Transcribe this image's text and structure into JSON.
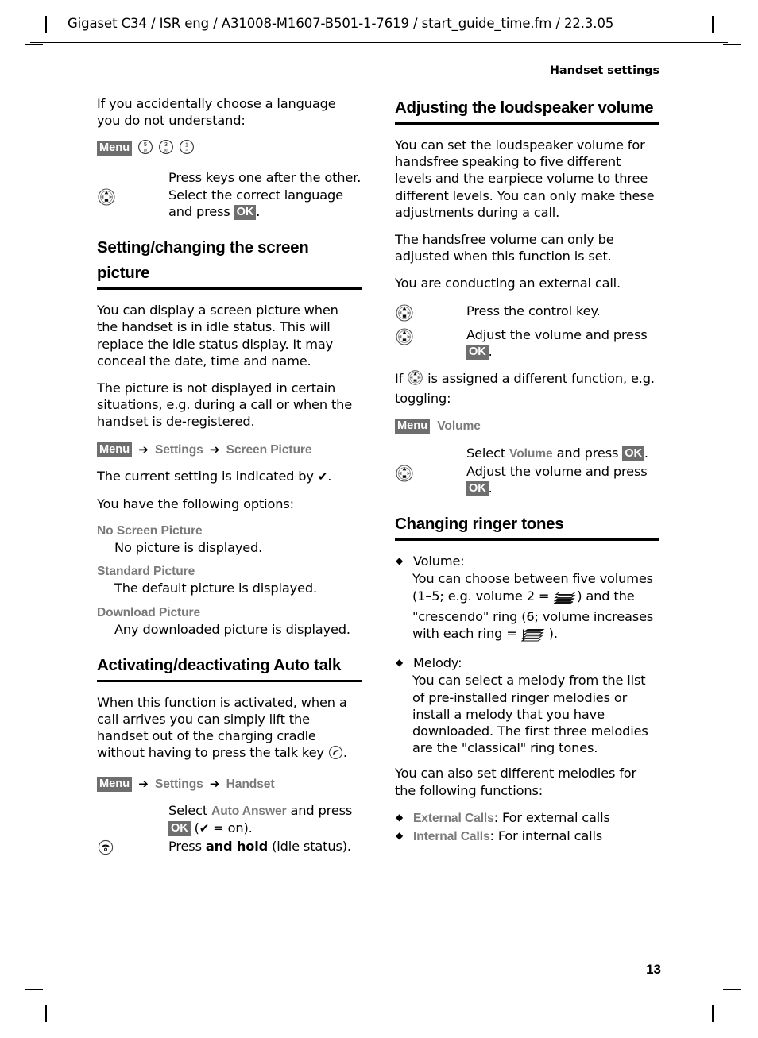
{
  "header": {
    "running_head": "Gigaset C34 / ISR eng / A31008-M1607-B501-1-7619 / start_guide_time.fm / 22.3.05",
    "chapter_label": "Handset settings"
  },
  "left_column": {
    "intro_paragraph": "If you accidentally choose a language you do not understand:",
    "language_steps": {
      "menu_key_label": "Menu",
      "keypad_icons": [
        "key-5-jkl-icon",
        "key-3-def-icon",
        "key-1-icon"
      ],
      "step1_text": "Press keys one after the other.",
      "step2_icon": "control-key-icon",
      "step2_text_before": "Select the correct language and press ",
      "step2_ok_label": "OK",
      "step2_text_after": "."
    },
    "section_screen_picture": {
      "heading": "Setting/changing the screen picture",
      "para1": "You can display a screen picture when the handset is in idle status. This will replace the idle status display. It may conceal the date, time and name.",
      "para2": "The picture is not displayed in certain situations, e.g. during a call or when the handset is de-registered.",
      "menu_path": {
        "menu_key_label": "Menu",
        "arrow": "➔",
        "item1": "Settings",
        "item2": "Screen Picture"
      },
      "para3_before": "The current setting is indicated by ",
      "para3_check": "✔",
      "para3_after": ".",
      "para4": "You have the following options:",
      "options": [
        {
          "term": "No Screen Picture",
          "desc": "No picture is displayed."
        },
        {
          "term": "Standard Picture",
          "desc": "The default picture is displayed."
        },
        {
          "term": "Download Picture",
          "desc": "Any downloaded picture is displayed."
        }
      ]
    },
    "section_auto_talk": {
      "heading": "Activating/deactivating Auto talk",
      "para1_before": "When this function is activated, when a call arrives you can simply lift the handset out of the charging cradle without having to press the talk key ",
      "para1_icon": "talk-key-icon",
      "para1_after": ".",
      "menu_path": {
        "menu_key_label": "Menu",
        "arrow": "➔",
        "item1": "Settings",
        "item2": "Handset"
      },
      "step1_text_before": "Select ",
      "step1_term": "Auto Answer",
      "step1_text_mid": " and press ",
      "step1_ok_label": "OK",
      "step1_text_after_open": " (",
      "step1_check": "✔",
      "step1_text_after": " = on).",
      "step2_icon": "end-call-key-icon",
      "step2_text_before": "Press ",
      "step2_bold": "and hold",
      "step2_text_after": " (idle status)."
    }
  },
  "right_column": {
    "section_loudspeaker": {
      "heading": "Adjusting the loudspeaker volume",
      "para1": "You can set the loudspeaker volume for handsfree speaking to five different levels and the earpiece volume to three different levels. You can only make these adjustments during a call.",
      "para2": "The handsfree volume can only be adjusted when this function is set.",
      "para3": "You are conducting an external call.",
      "step1_icon": "control-key-icon",
      "step1_text": "Press the control key.",
      "step2_icon": "control-key-icon",
      "step2_text_before": "Adjust the volume and press ",
      "step2_ok_label": "OK",
      "step2_text_after": ".",
      "cond_before": "If ",
      "cond_icon": "control-key-icon",
      "cond_after": " is assigned a different function, e.g. toggling:",
      "menu_line": {
        "menu_key_label": "Menu",
        "item": "Volume"
      },
      "step3_text_before": "Select ",
      "step3_term": "Volume",
      "step3_text_mid": " and press ",
      "step3_ok_label": "OK",
      "step3_text_after": ".",
      "step4_icon": "control-key-icon",
      "step4_text_before": "Adjust the volume and press ",
      "step4_ok_label": "OK",
      "step4_text_after": "."
    },
    "section_ringer": {
      "heading": "Changing ringer tones",
      "bullet_volume": {
        "title": "Volume:",
        "line1": "You can choose between five volumes",
        "line2_before": "(1–5; e.g. volume 2 = ",
        "line2_icon": "volume-level-2-icon",
        "line2_after": ") and the",
        "line3": "\"crescendo\" ring (6; volume increases",
        "line4_before": "with each ring = ",
        "line4_icon": "volume-crescendo-icon",
        "line4_after": " )."
      },
      "bullet_melody": {
        "title": "Melody:",
        "body": "You can select a melody from the list of pre-installed ringer melodies or install a melody that you have downloaded. The first three melodies are the \"classical\" ring tones."
      },
      "para_functions": "You can also set different melodies for the following functions:",
      "function_bullets": [
        {
          "term": "External Calls",
          "desc": ": For external calls"
        },
        {
          "term": "Internal Calls",
          "desc": ": For internal calls"
        }
      ],
      "bullet_glyph": "◆"
    }
  },
  "footer": {
    "page_number": "13"
  }
}
